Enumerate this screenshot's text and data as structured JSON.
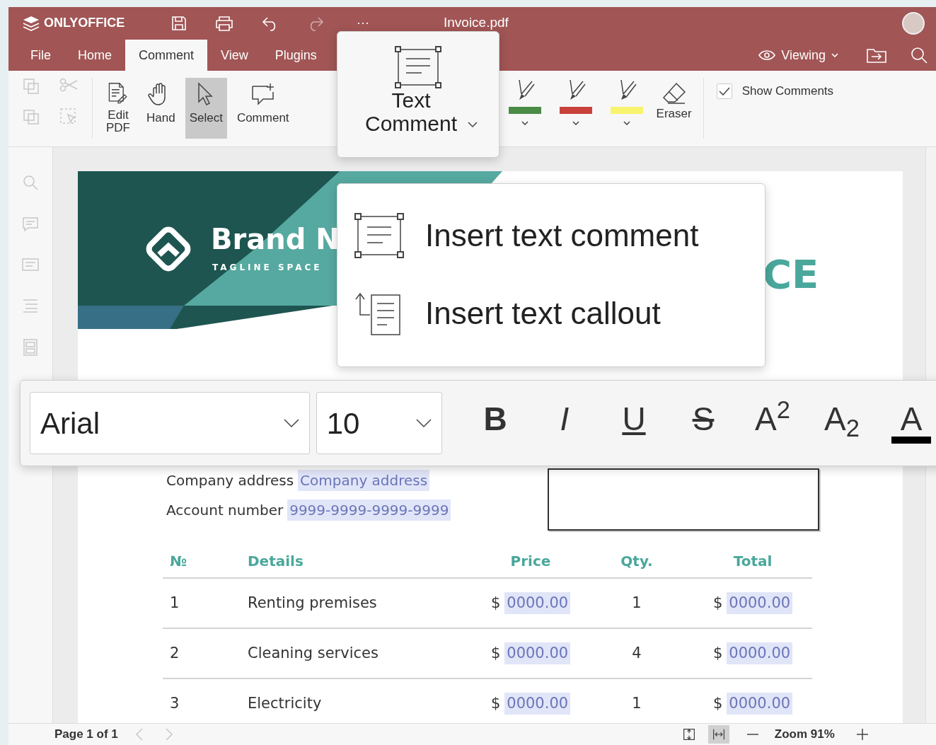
{
  "header": {
    "logo": "ONLYOFFICE",
    "more": "···",
    "title": "Invoice.pdf",
    "mode": "Viewing"
  },
  "tabs": [
    {
      "label": "File",
      "selected": false
    },
    {
      "label": "Home",
      "selected": false
    },
    {
      "label": "Comment",
      "selected": true
    },
    {
      "label": "View",
      "selected": false
    },
    {
      "label": "Plugins",
      "selected": false
    }
  ],
  "toolbar": {
    "tools": [
      {
        "label": "Edit PDF",
        "kind": "edit",
        "selected": false
      },
      {
        "label": "Hand",
        "kind": "hand",
        "selected": false
      },
      {
        "label": "Select",
        "kind": "select",
        "selected": true
      },
      {
        "label": "Comment",
        "kind": "comment",
        "selected": false
      }
    ],
    "pens": [
      {
        "kind": "pen",
        "color": "#4a8c46"
      },
      {
        "kind": "pen",
        "color": "#c8413b"
      },
      {
        "kind": "marker",
        "color": "#f8f46e"
      }
    ],
    "eraser": "Eraser",
    "show_comments": {
      "label": "Show Comments",
      "checked": true
    }
  },
  "text_comment_button": {
    "label": "Text Comment"
  },
  "menu": [
    {
      "kind": "comment",
      "label": "Insert text comment"
    },
    {
      "kind": "callout",
      "label": "Insert text callout"
    }
  ],
  "font_bar": {
    "font": "Arial",
    "size": "10",
    "buttons": [
      {
        "kind": "bold",
        "label": "B"
      },
      {
        "kind": "italic",
        "label": "I"
      },
      {
        "kind": "underline",
        "label": "U"
      },
      {
        "kind": "strike",
        "label": "S"
      },
      {
        "kind": "superscript",
        "label": "A$^{2}$"
      },
      {
        "kind": "subscript",
        "label": "A$_{2}$"
      },
      {
        "kind": "color",
        "label": "A",
        "color": "#000000"
      }
    ]
  },
  "document": {
    "brand": "Brand N",
    "tagline": "TAGLINE SPACE",
    "title_fragment": "CE",
    "fields": [
      {
        "label": "Company address",
        "value": "Company address"
      },
      {
        "label": "Account number",
        "value": "9999-9999-9999-9999"
      }
    ],
    "table": {
      "columns": [
        "№",
        "Details",
        "Price",
        "Qty.",
        "Total"
      ],
      "rows": [
        {
          "no": "1",
          "details": "Renting premises",
          "price": {
            "currency": "$",
            "amount": "0000.00"
          },
          "qty": "1",
          "total": {
            "currency": "$",
            "amount": "0000.00"
          }
        },
        {
          "no": "2",
          "details": "Cleaning services",
          "price": {
            "currency": "$",
            "amount": "0000.00"
          },
          "qty": "4",
          "total": {
            "currency": "$",
            "amount": "0000.00"
          }
        },
        {
          "no": "3",
          "details": "Electricity",
          "price": {
            "currency": "$",
            "amount": "0000.00"
          },
          "qty": "1",
          "total": {
            "currency": "$",
            "amount": "0000.00"
          }
        }
      ]
    }
  },
  "status_bar": {
    "page": "Page 1 of 1",
    "zoom": "Zoom 91%",
    "fit_buttons": [
      {
        "kind": "fit-page",
        "selected": false
      },
      {
        "kind": "fit-width",
        "selected": true
      }
    ]
  }
}
